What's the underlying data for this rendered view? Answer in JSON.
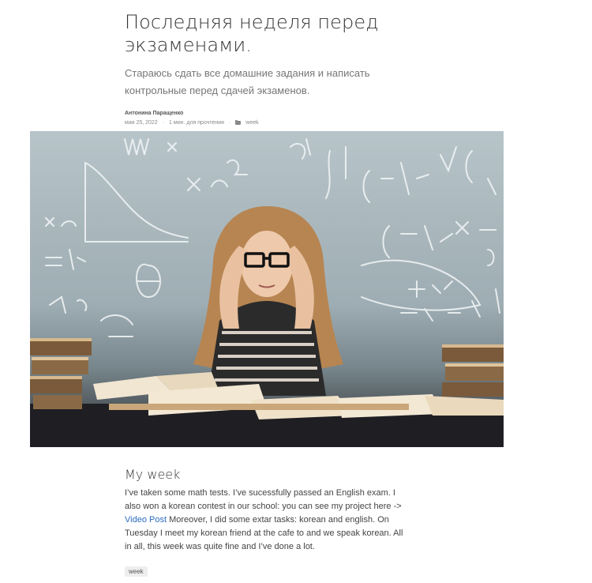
{
  "post": {
    "title": "Последняя неделя перед экзаменами.",
    "subtitle": "Стараюсь сдать все домашние задания и написать контрольные перед сдачей экзаменов.",
    "author": "Антонина Паращенко",
    "date": "мая 25, 2022",
    "read_time": "1 мин. для прочтения",
    "category": "week",
    "meta_separator": "·",
    "folder_icon": "folder-icon"
  },
  "article": {
    "heading": "My week",
    "text_before_link": "I’ve taken some math tests. I’ve sucessfully passed an English exam. I also won a korean contest in our school: you can see my project here -> ",
    "link_text": "Video Post",
    "text_after_link": " Moreover, I did some extar tasks: korean and english. On Tuesday I meet my korean friend at the cafe to and we speak korean. All in all, this week was quite fine and I’ve done a lot.",
    "link_color": "#2a6cc0"
  },
  "tags": [
    "week"
  ]
}
